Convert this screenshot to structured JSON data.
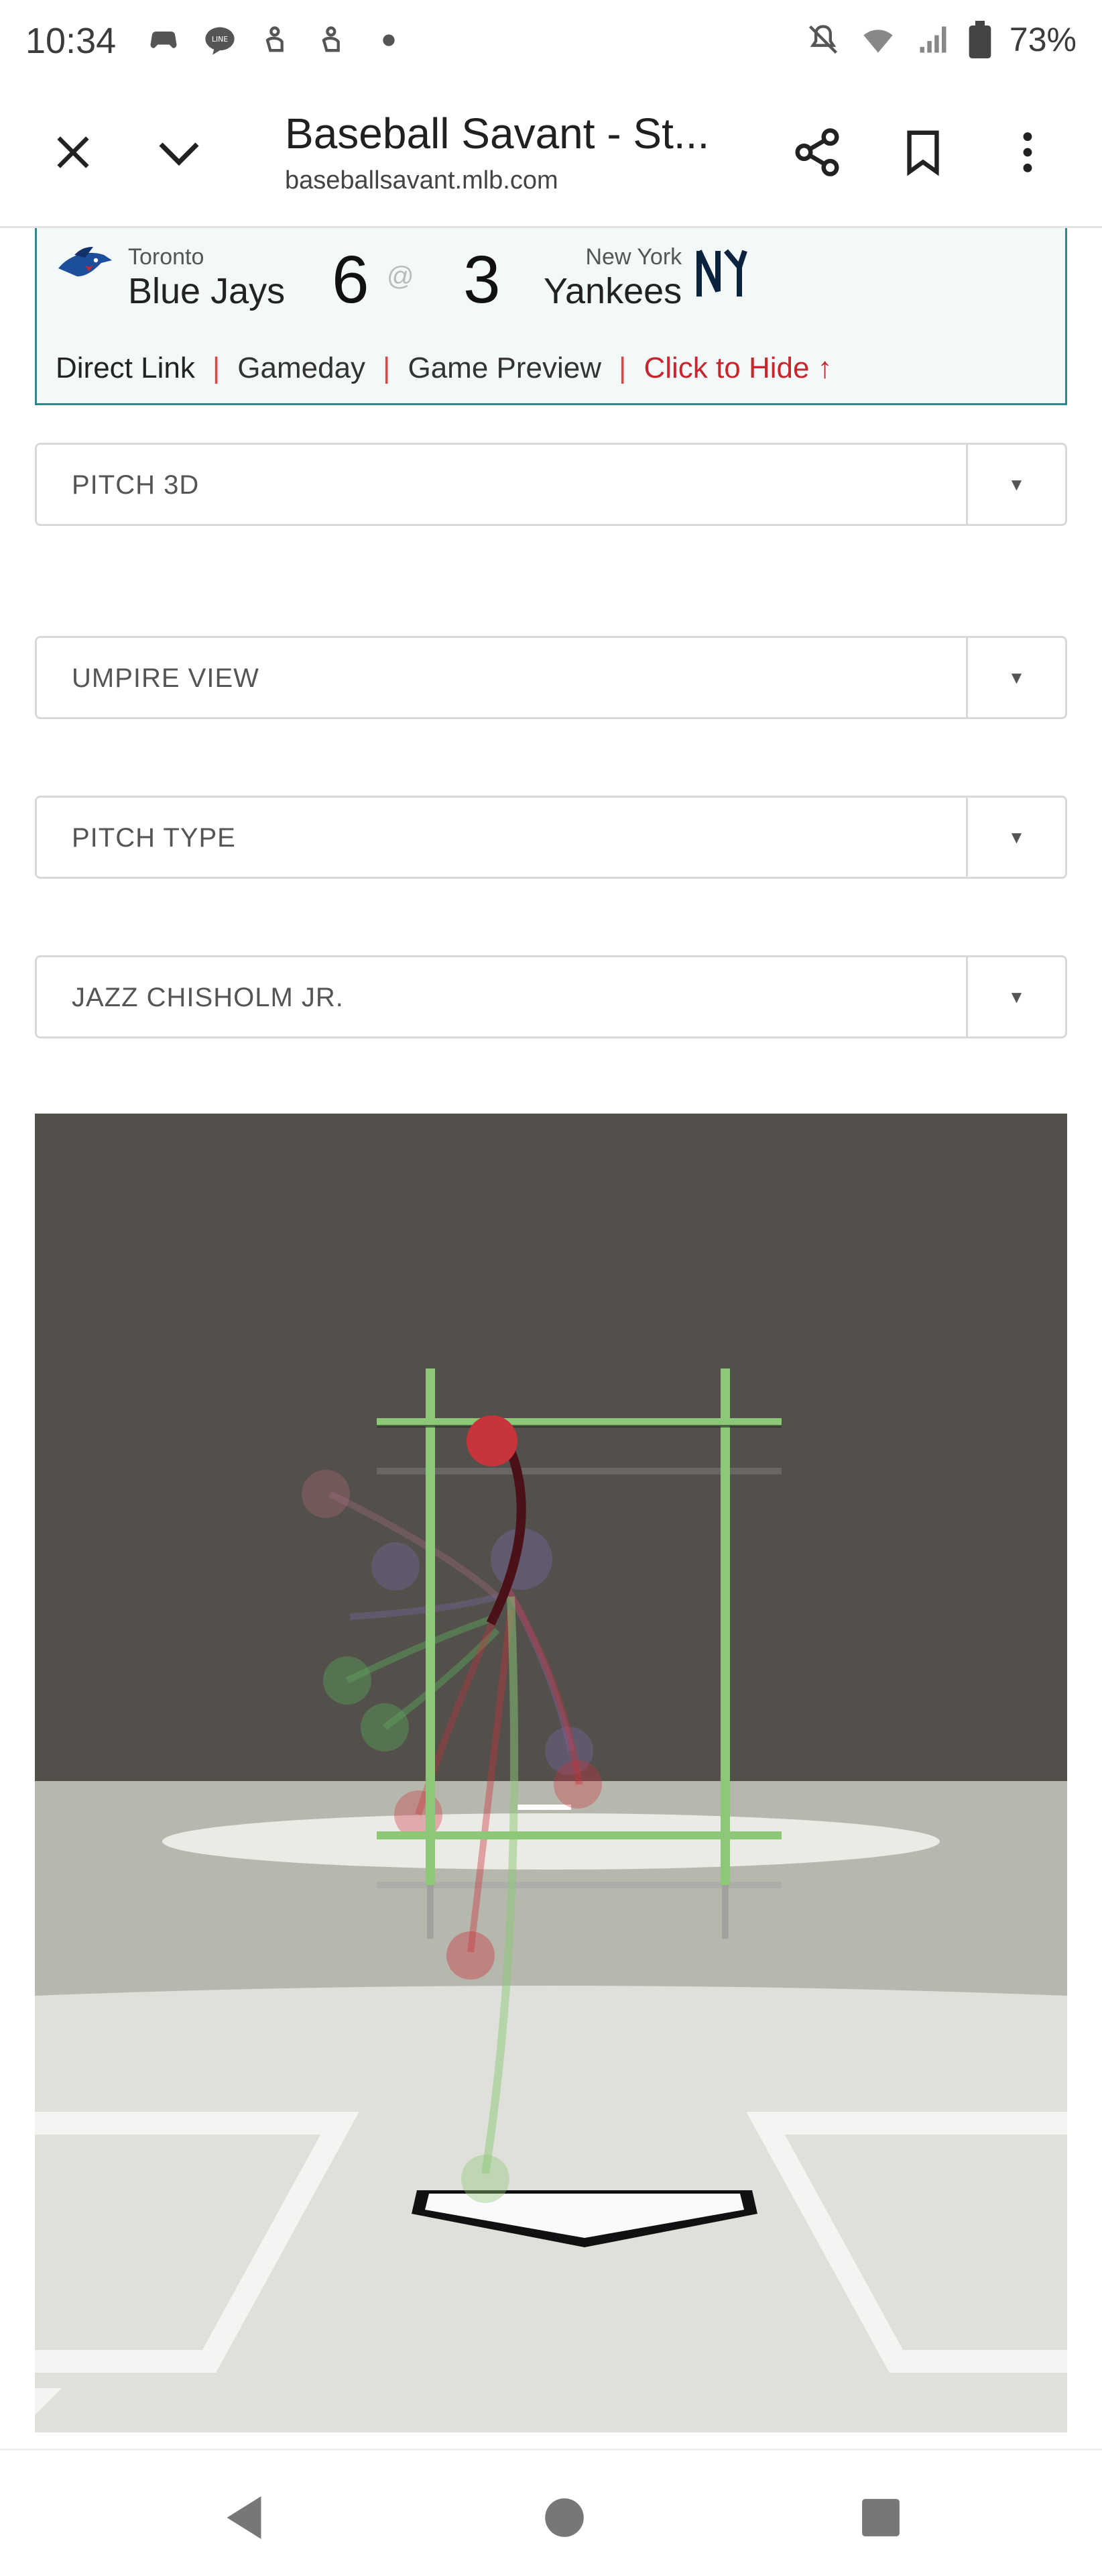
{
  "status": {
    "time": "10:34",
    "battery": "73%",
    "left_icons": [
      "game-controller-icon",
      "line-app-icon",
      "notification-icon",
      "notification-icon",
      "dot-icon"
    ],
    "right_icons": [
      "mute-icon",
      "wifi-icon",
      "signal-icon",
      "battery-icon"
    ]
  },
  "browser": {
    "title": "Baseball Savant - St...",
    "url": "baseballsavant.mlb.com",
    "close_icon": "close-icon",
    "collapse_icon": "chevron-down-icon",
    "share_icon": "share-icon",
    "bookmark_icon": "bookmark-icon",
    "menu_icon": "more-vert-icon"
  },
  "game": {
    "away_city": "Toronto",
    "away_name": "Blue Jays",
    "away_score": "6",
    "at": "@",
    "home_score": "3",
    "home_city": "New York",
    "home_name": "Yankees",
    "links": {
      "direct": "Direct Link",
      "gameday": "Gameday",
      "preview": "Game Preview",
      "hide": "Click to Hide ↑"
    }
  },
  "dropdowns": {
    "view_mode": "PITCH 3D",
    "camera": "UMPIRE VIEW",
    "color_by": "PITCH TYPE",
    "player": "JAZZ CHISHOLM JR.",
    "caret": "▼"
  },
  "colors": {
    "accent": "#2a8a8e",
    "link_sep": "#dd4444",
    "hide_link": "#c8262d",
    "backdrop": "#534f4a",
    "field": "#b7b8ad",
    "grass": "#e0e0da",
    "zone_green": "#8cc878",
    "pitch_red": "#c8343c"
  }
}
